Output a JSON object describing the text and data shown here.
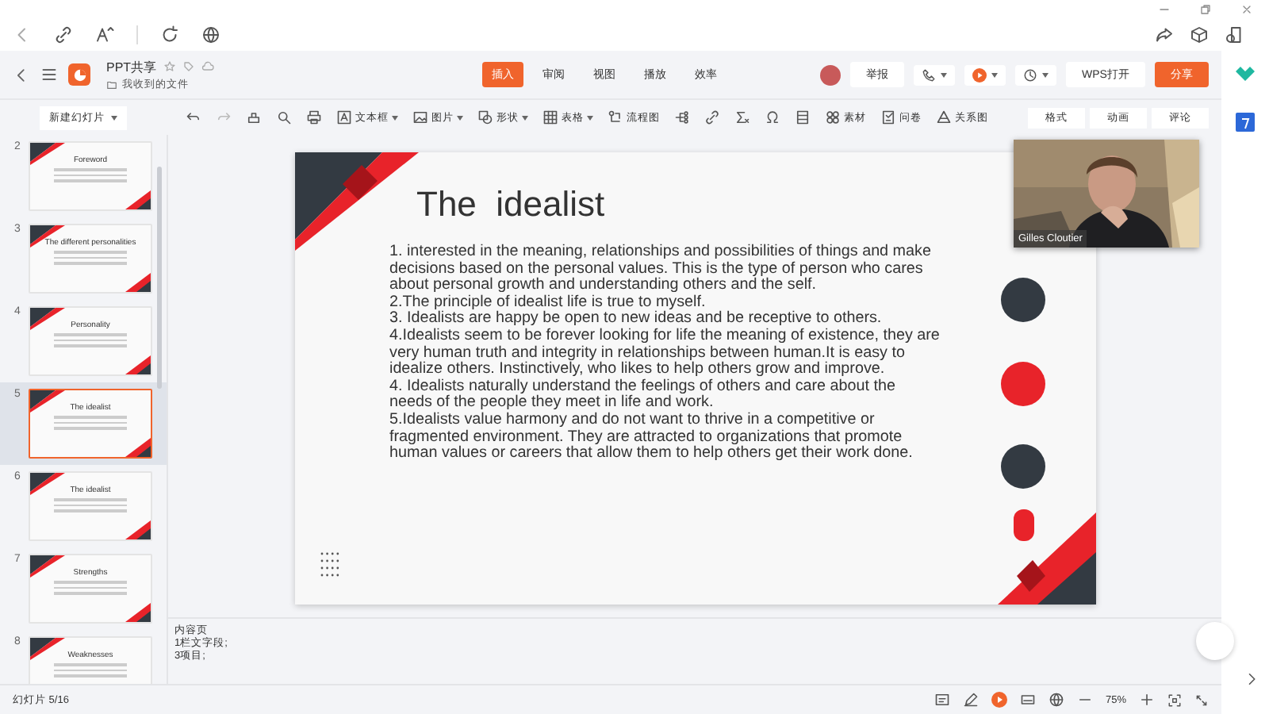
{
  "document": {
    "title": "PPT共享",
    "location": "我收到的文件"
  },
  "menu_tabs": [
    {
      "label": "插入",
      "selected": true
    },
    {
      "label": "审阅",
      "selected": false
    },
    {
      "label": "视图",
      "selected": false
    },
    {
      "label": "播放",
      "selected": false
    },
    {
      "label": "效率",
      "selected": false
    }
  ],
  "header_buttons": [
    {
      "label": "举报",
      "kind": "plain"
    },
    {
      "label": "WPS打开",
      "kind": "plain"
    },
    {
      "label": "分享",
      "kind": "primary"
    }
  ],
  "new_slide_button": "新建幻灯片",
  "toolbar": [
    {
      "label": "文本框",
      "dropdown": true
    },
    {
      "label": "图片",
      "dropdown": true
    },
    {
      "label": "形状",
      "dropdown": true
    },
    {
      "label": "表格",
      "dropdown": true
    },
    {
      "label": "流程图",
      "dropdown": false
    },
    {
      "label": "素材",
      "dropdown": false
    },
    {
      "label": "问卷",
      "dropdown": false
    },
    {
      "label": "关系图",
      "dropdown": false
    }
  ],
  "panel_tabs": [
    "格式",
    "动画",
    "评论"
  ],
  "slides": [
    {
      "number": "2",
      "title": "Foreword",
      "selected": false
    },
    {
      "number": "3",
      "title": "The different personalities",
      "selected": false
    },
    {
      "number": "4",
      "title": "Personality",
      "selected": false
    },
    {
      "number": "5",
      "title": "The idealist",
      "selected": true
    },
    {
      "number": "6",
      "title": "The idealist",
      "selected": false
    },
    {
      "number": "7",
      "title": "Strengths",
      "selected": false
    },
    {
      "number": "8",
      "title": "Weaknesses",
      "selected": false
    }
  ],
  "current_slide": {
    "title": "The  idealist",
    "items": [
      "1. interested in the meaning, relationships and possibilities of things and make decisions based on the personal values. This is the type of person who cares about personal growth and understanding others and the self.",
      "2.The principle of idealist life is true to myself.",
      "3. Idealists are happy be open to new ideas and be receptive to others.",
      "4.Idealists seem to be forever looking for life the meaning of existence, they are very human truth and integrity in relationships between human.It is easy to idealize others. Instinctively, who likes to help others grow and improve.",
      "4. Idealists naturally understand the feelings of others and care about the needs of the people they meet in life and work.",
      "5.Idealists value harmony and do not want to thrive in a competitive or fragmented environment. They are attracted to organizations that promote human values or careers that allow them to help others get their work done."
    ]
  },
  "video": {
    "name": "Gilles Cloutier"
  },
  "notes": [
    "内容页",
    "1栏文字段;",
    "3项目;"
  ],
  "status_bar": {
    "slide_counter": "幻灯片 5/16",
    "zoom": "75%"
  }
}
